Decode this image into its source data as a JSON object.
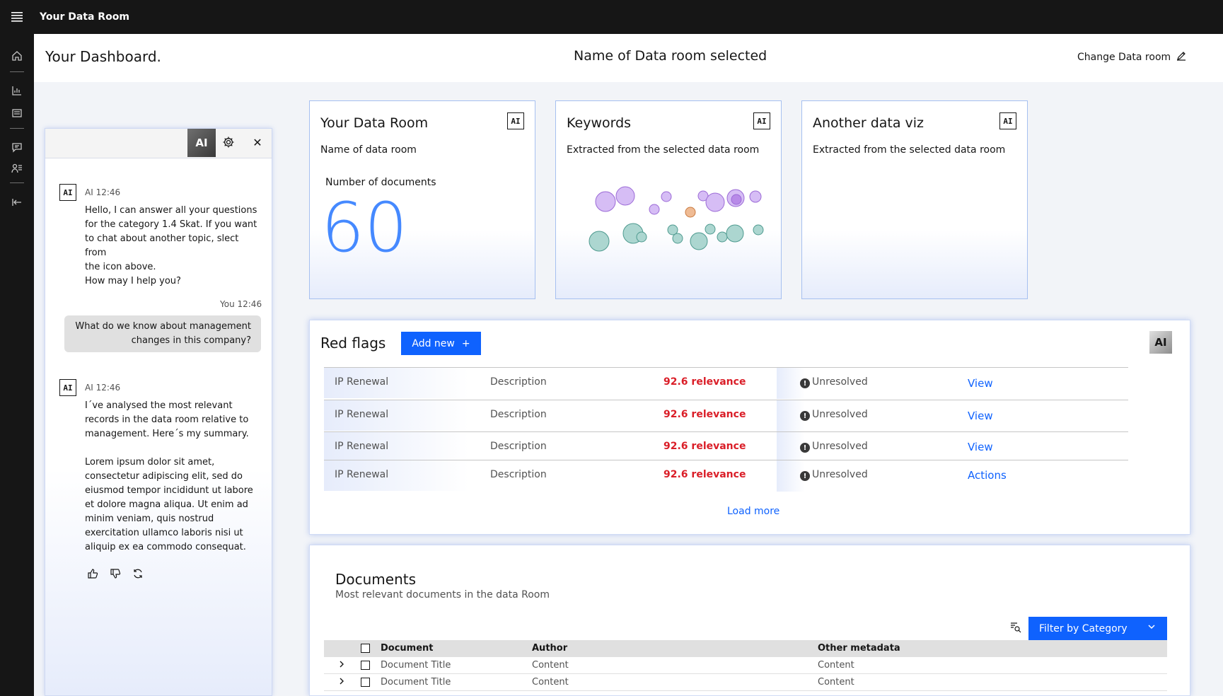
{
  "topbar": {
    "title": "Your Data Room"
  },
  "header": {
    "dashboard": "Your Dashboard.",
    "room": "Name of Data room selected",
    "change": "Change Data room"
  },
  "chat": {
    "ai_button": "AI",
    "badge": "AI",
    "msg1_meta": "AI 12:46",
    "msg1_body": "Hello, I can answer all your questions\nfor the category 1.4 Skat. If you want\nto chat about another topic, slect from\nthe icon above.\nHow may I help you?",
    "user_meta": "You 12:46",
    "user_body": "What do we know about management changes in this company?",
    "msg2_meta": "AI 12:46",
    "msg2_body": "I´ve analysed the most relevant\nrecords in the data room relative to\nmanagement. Here´s my summary.\n\nLorem ipsum dolor sit amet,\nconsectetur adipiscing elit, sed do\neiusmod tempor incididunt ut labore\net dolore magna aliqua. Ut enim ad\nminim veniam, quis nostrud\nexercitation ullamco laboris nisi ut\naliquip ex ea commodo consequat."
  },
  "tiles": [
    {
      "title": "Your Data Room",
      "sub": "Name of data room",
      "label": "Number of documents",
      "value": "60",
      "badge": "AI"
    },
    {
      "title": "Keywords",
      "sub": "Extracted from the selected data room",
      "badge": "AI"
    },
    {
      "title": "Another data viz",
      "sub": "Extracted from the selected data room",
      "badge": "AI"
    }
  ],
  "redflags": {
    "title": "Red flags",
    "add": "Add new",
    "ai": "AI",
    "rows": [
      {
        "name": "IP Renewal",
        "desc": "Description",
        "rel": "92.6 relevance",
        "status": "Unresolved",
        "action": "View"
      },
      {
        "name": "IP Renewal",
        "desc": "Description",
        "rel": "92.6 relevance",
        "status": "Unresolved",
        "action": "View"
      },
      {
        "name": "IP Renewal",
        "desc": "Description",
        "rel": "92.6 relevance",
        "status": "Unresolved",
        "action": "View"
      },
      {
        "name": "IP Renewal",
        "desc": "Description",
        "rel": "92.6 relevance",
        "status": "Unresolved",
        "action": "Actions"
      }
    ],
    "load_more": "Load more"
  },
  "documents": {
    "title": "Documents",
    "sub": "Most relevant documents in the data Room",
    "filter_prefix": "Filter by",
    "filter_value": "Category",
    "columns": [
      "Document",
      "Author",
      "Other metadata"
    ],
    "rows": [
      [
        "Document Title",
        "Content",
        "Content"
      ],
      [
        "Document Title",
        "Content",
        "Content"
      ]
    ]
  },
  "colors": {
    "accent": "#0f62fe",
    "danger": "#da1e28",
    "bubble_purple": "#c9a6f2",
    "bubble_teal": "#9fcfc8",
    "bubble_orange": "#e8a878"
  }
}
